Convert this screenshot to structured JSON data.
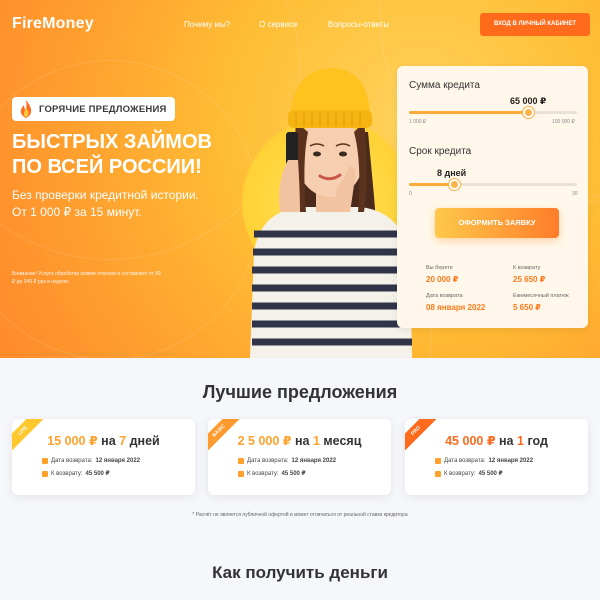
{
  "header": {
    "logo": "FireMoney",
    "nav": [
      "Почему мы?",
      "О сервисе",
      "Вопросы-ответы"
    ],
    "cabinet_button": "ВХОД В ЛИЧНЫЙ КАБИНЕТ"
  },
  "hero": {
    "badge": "ГОРЯЧИЕ ПРЕДЛОЖЕНИЯ",
    "title_line1": "БЫСТРЫХ ЗАЙМОВ",
    "title_line2": "ПО ВСЕЙ РОССИИ!",
    "subtitle_line1": "Без проверки кредитной истории.",
    "subtitle_line2": "От 1 000 ₽ за 15 минут.",
    "note": "Внимание! Услуга обработки заявки платная и составляет от 99 ₽ до 349 ₽ раз в неделю"
  },
  "calculator": {
    "amount_label": "Сумма кредита",
    "amount_value": "65 000 ₽",
    "amount_min": "1 000 ₽",
    "amount_max": "100 000 ₽",
    "amount_fraction": 0.71,
    "term_label": "Срок кредита",
    "term_value": "8 дней",
    "term_min": "0",
    "term_max": "30",
    "term_fraction": 0.27,
    "apply_button": "ОФОРМИТЬ ЗАЯВКУ",
    "info": [
      {
        "label": "Вы берете",
        "value": "20 000 ₽"
      },
      {
        "label": "К возврату",
        "value": "25 650 ₽"
      },
      {
        "label": "Дата возврата",
        "value": "08 января 2022"
      },
      {
        "label": "Ежемесячный платеж",
        "value": "5 650 ₽"
      }
    ]
  },
  "offers": {
    "title": "Лучшие предложения",
    "cards": [
      {
        "ribbon": "LITE",
        "ribbon_color": "#ffc92e",
        "amount": "15 000 ₽",
        "on": "на",
        "num": "7",
        "unit": "дней",
        "date_label": "Дата возврата:",
        "date_value": "12 января 2022",
        "return_label": "К возврату:",
        "return_value": "45 500 ₽"
      },
      {
        "ribbon": "BASIC",
        "ribbon_color": "#ff9a2e",
        "amount": "2 5 000 ₽",
        "on": "на",
        "num": "1",
        "unit": "месяц",
        "date_label": "Дата возврата:",
        "date_value": "12 января 2022",
        "return_label": "К возврату:",
        "return_value": "45 500 ₽"
      },
      {
        "ribbon": "PRO",
        "ribbon_color": "#ff6a1c",
        "amount": "45 000 ₽",
        "on": "на",
        "num": "1",
        "unit": "год",
        "date_label": "Дата возврата:",
        "date_value": "12 января 2022",
        "return_label": "К возврату:",
        "return_value": "45 500 ₽"
      }
    ],
    "disclaimer": "* Расчёт не является публичной офертой и может отличаться от реальной ставки кредитора"
  },
  "how": {
    "title": "Как получить деньги"
  },
  "colors": {
    "accent": "#ff7a1a",
    "amount": "#ffa12c"
  }
}
